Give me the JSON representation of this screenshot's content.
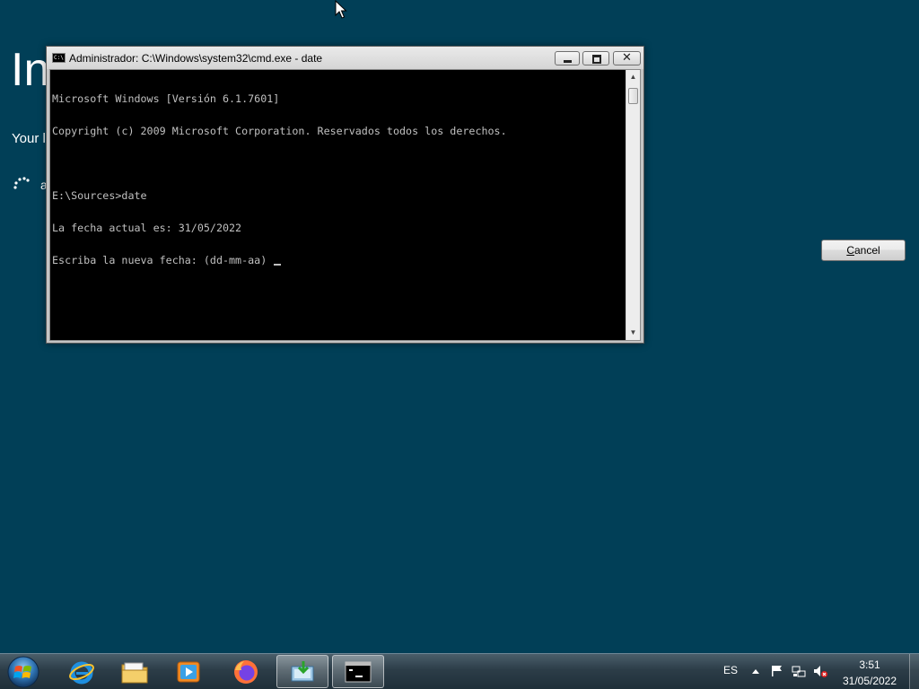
{
  "installer": {
    "title": "In",
    "subtitle": "Your l",
    "status": "a",
    "cancel_label": "Cancel"
  },
  "cmd": {
    "title": "Administrador: C:\\Windows\\system32\\cmd.exe - date",
    "icon_label": "C:\\",
    "lines": [
      "Microsoft Windows [Versión 6.1.7601]",
      "Copyright (c) 2009 Microsoft Corporation. Reservados todos los derechos.",
      "",
      "E:\\Sources>date",
      "La fecha actual es: 31/05/2022",
      "Escriba la nueva fecha: (dd-mm-aa) "
    ]
  },
  "taskbar": {
    "items": [
      {
        "name": "start-orb",
        "icon": "windows-logo-icon"
      },
      {
        "name": "internet-explorer",
        "icon": "internet-explorer-icon"
      },
      {
        "name": "file-explorer",
        "icon": "folder-icon"
      },
      {
        "name": "media-player",
        "icon": "media-player-icon"
      },
      {
        "name": "firefox",
        "icon": "firefox-icon"
      },
      {
        "name": "setup",
        "icon": "setup-icon"
      },
      {
        "name": "cmd",
        "icon": "cmd-icon"
      }
    ],
    "tray": {
      "language": "ES",
      "time": "3:51",
      "date": "31/05/2022"
    }
  },
  "colors": {
    "desktop_background": "#013f57",
    "console_background": "#000000",
    "console_text": "#c0c0c0"
  }
}
